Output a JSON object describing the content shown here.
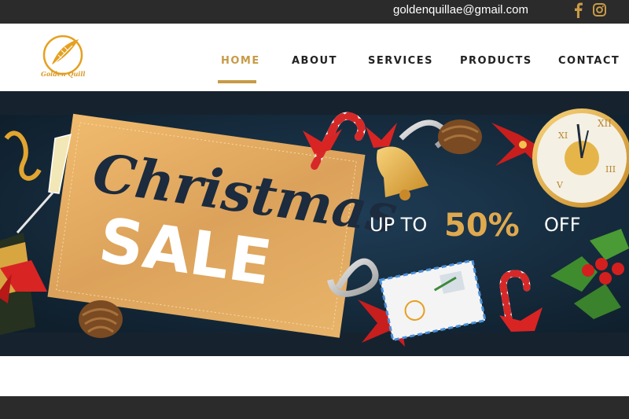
{
  "topbar": {
    "email": "goldenquillae@gmail.com",
    "social": [
      "facebook-icon",
      "instagram-icon"
    ]
  },
  "brand": {
    "name": "Golden Quill"
  },
  "nav": {
    "items": [
      {
        "label": "HOME",
        "active": true
      },
      {
        "label": "ABOUT",
        "active": false
      },
      {
        "label": "SERVICES",
        "active": false
      },
      {
        "label": "PRODUCTS",
        "active": false
      },
      {
        "label": "CONTACT",
        "active": false
      }
    ]
  },
  "banner": {
    "script_title": "Christmas",
    "title": "SALE",
    "promo_prefix": "UP TO",
    "promo_value": "50%",
    "promo_suffix": "OFF"
  },
  "colors": {
    "accent": "#c89a46",
    "dark_bar": "#2b2b2b",
    "banner_bg": "#172a3a",
    "card": "#e3a95c"
  }
}
